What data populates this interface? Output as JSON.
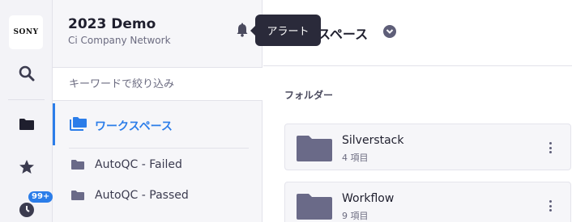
{
  "rail": {
    "logo_text": "SONY",
    "icons": [
      "search-icon",
      "folder-icon",
      "star-icon",
      "clock-icon"
    ],
    "badge": "99+"
  },
  "sidebar": {
    "title": "2023 Demo",
    "subtitle": "Ci Company Network",
    "search_placeholder": "キーワードで絞り込み",
    "active_item": {
      "label": "ワークスペース",
      "icon": "folders-icon"
    },
    "items": [
      {
        "label": "AutoQC - Failed",
        "icon": "folder-icon"
      },
      {
        "label": "AutoQC - Passed",
        "icon": "folder-icon"
      }
    ]
  },
  "tooltip": {
    "text": "アラート"
  },
  "main": {
    "title": "スペース",
    "section_label": "フォルダー",
    "folders": [
      {
        "name": "Silverstack",
        "count": "4 項目"
      },
      {
        "name": "Workflow",
        "count": "9 項目"
      }
    ]
  },
  "colors": {
    "accent": "#2b7de9",
    "folder": "#6a6a88",
    "tooltip_bg": "#2a2a3a"
  }
}
